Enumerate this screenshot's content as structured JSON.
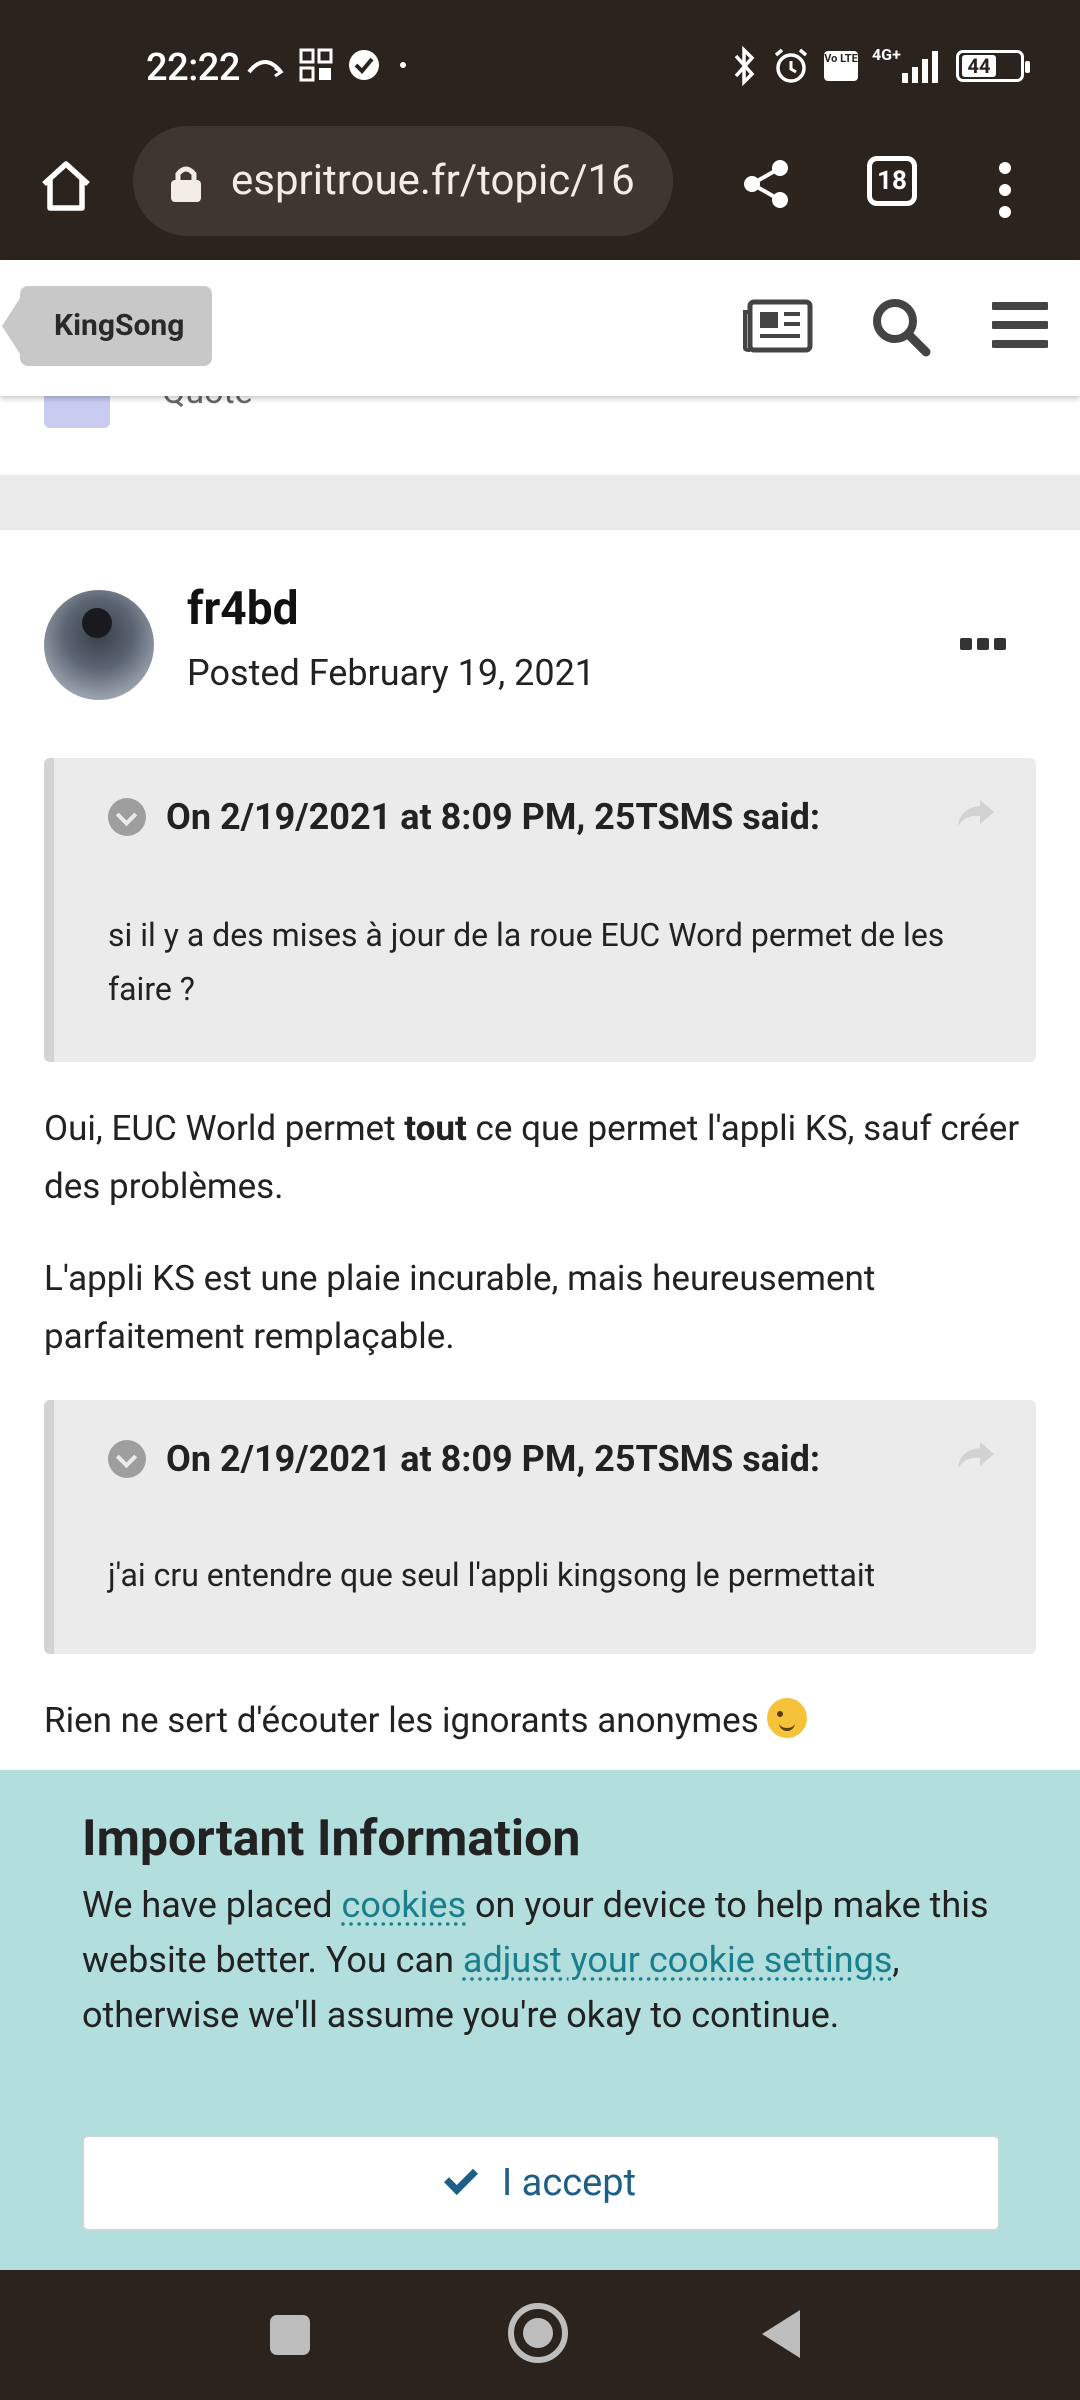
{
  "status_bar": {
    "time": "22:22",
    "network": "4G+",
    "volte": "Vo LTE",
    "battery": "44"
  },
  "browser": {
    "url": "espritroue.fr/topic/16",
    "tab_count": "18"
  },
  "site_header": {
    "breadcrumb": "KingSong"
  },
  "partial_row": {
    "quote_label": "Quote"
  },
  "post": {
    "author": "fr4bd",
    "posted": "Posted February 19, 2021",
    "quote1": {
      "citation": "On 2/19/2021 at 8:09 PM, 25TSMS said:",
      "body": "si il y a des mises à jour de la roue EUC Word permet de les faire ?"
    },
    "para1_before": "Oui, EUC World permet ",
    "para1_bold": "tout",
    "para1_after": " ce que permet l'appli KS, sauf créer des problèmes.",
    "para2": "L'appli KS est une plaie incurable, mais heureusement parfaitement remplaçable.",
    "quote2": {
      "citation": "On 2/19/2021 at 8:09 PM, 25TSMS said:",
      "body": "j'ai cru entendre que seul l'appli kingsong le permettait"
    },
    "para3": "Rien ne sert d'écouter les ignorants anonymes"
  },
  "cookie_banner": {
    "title": "Important Information",
    "text_1": "We have placed ",
    "link_cookies": "cookies",
    "text_2": " on your device to help make this website better. You can ",
    "link_settings": "adjust your cookie settings",
    "text_3": ", otherwise we'll assume you're okay to continue.",
    "accept_label": "I accept"
  },
  "colors": {
    "system_bar": "#2b241e",
    "cookie_bg": "#b2dedd",
    "link": "#1a7f8c",
    "accept_text": "#1d5f86"
  }
}
